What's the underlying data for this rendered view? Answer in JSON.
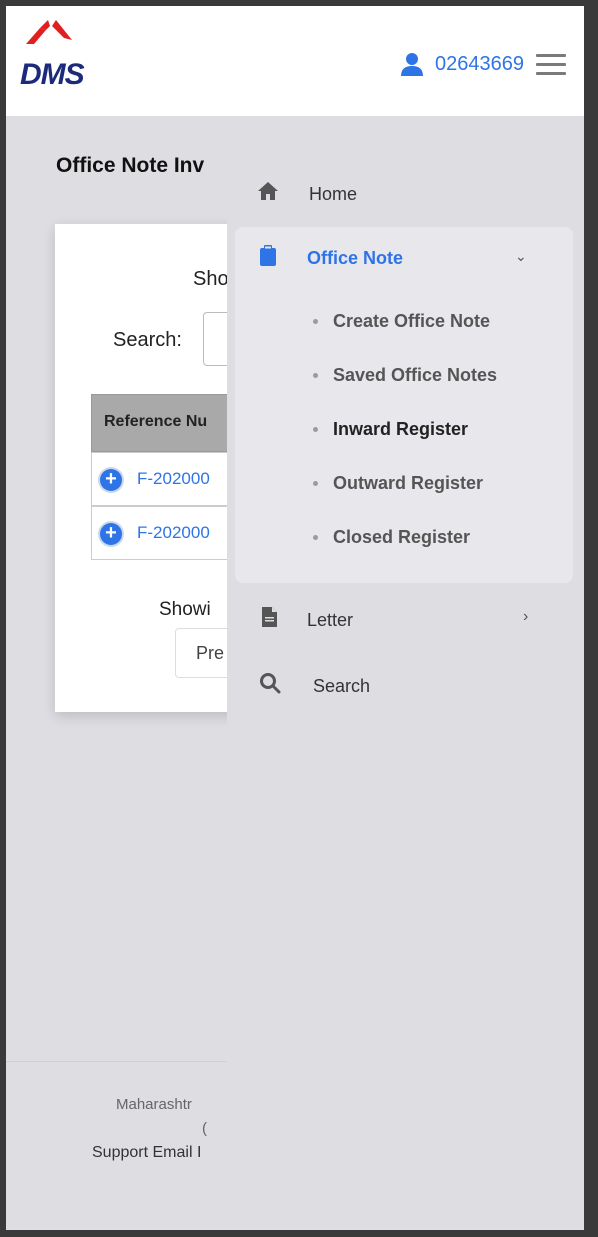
{
  "header": {
    "logo_text": "DMS",
    "user_id": "02643669",
    "brand_color": "#2e74e6"
  },
  "content": {
    "page_title": "Office Note Inv",
    "show_label": "Sho",
    "search_label": "Search:",
    "table_header": "Reference Nu",
    "rows": [
      {
        "ref": "F-202000"
      },
      {
        "ref": "F-202000"
      }
    ],
    "showing_label": "Showi",
    "prev_label": "Pre"
  },
  "footer": {
    "org": "Maharashtr",
    "line2": "(",
    "support": "Support Email I"
  },
  "drawer": {
    "home_label": "Home",
    "office_note_label": "Office Note",
    "office_note_submenu": [
      {
        "label": "Create Office Note"
      },
      {
        "label": "Saved Office Notes"
      },
      {
        "label": "Inward Register"
      },
      {
        "label": "Outward Register"
      },
      {
        "label": "Closed Register"
      }
    ],
    "letter_label": "Letter",
    "search_label": "Search"
  }
}
